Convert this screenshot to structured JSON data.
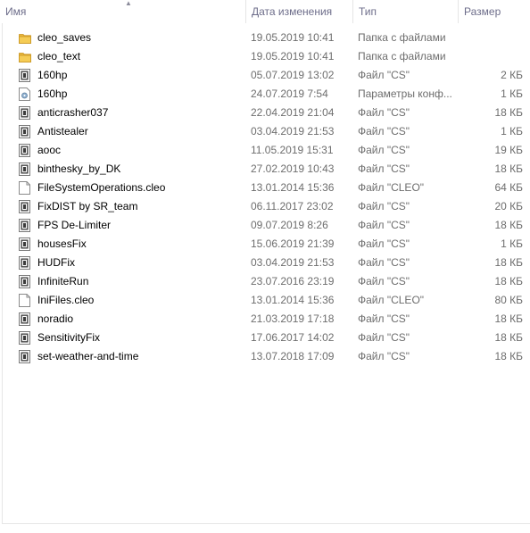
{
  "columns": {
    "name": "Имя",
    "date": "Дата изменения",
    "type": "Тип",
    "size": "Размер"
  },
  "files": [
    {
      "icon": "folder-icon",
      "name": "cleo_saves",
      "date": "19.05.2019 10:41",
      "type": "Папка с файлами",
      "size": ""
    },
    {
      "icon": "folder-icon",
      "name": "cleo_text",
      "date": "19.05.2019 10:41",
      "type": "Папка с файлами",
      "size": ""
    },
    {
      "icon": "cs-file-icon",
      "name": "160hp",
      "date": "05.07.2019 13:02",
      "type": "Файл \"CS\"",
      "size": "2 КБ"
    },
    {
      "icon": "settings-file-icon",
      "name": "160hp",
      "date": "24.07.2019 7:54",
      "type": "Параметры конф...",
      "size": "1 КБ"
    },
    {
      "icon": "cs-file-icon",
      "name": "anticrasher037",
      "date": "22.04.2019 21:04",
      "type": "Файл \"CS\"",
      "size": "18 КБ"
    },
    {
      "icon": "cs-file-icon",
      "name": "Antistealer",
      "date": "03.04.2019 21:53",
      "type": "Файл \"CS\"",
      "size": "1 КБ"
    },
    {
      "icon": "cs-file-icon",
      "name": "aooc",
      "date": "11.05.2019 15:31",
      "type": "Файл \"CS\"",
      "size": "19 КБ"
    },
    {
      "icon": "cs-file-icon",
      "name": "binthesky_by_DK",
      "date": "27.02.2019 10:43",
      "type": "Файл \"CS\"",
      "size": "18 КБ"
    },
    {
      "icon": "blank-file-icon",
      "name": "FileSystemOperations.cleo",
      "date": "13.01.2014 15:36",
      "type": "Файл \"CLEO\"",
      "size": "64 КБ"
    },
    {
      "icon": "cs-file-icon",
      "name": "FixDIST by SR_team",
      "date": "06.11.2017 23:02",
      "type": "Файл \"CS\"",
      "size": "20 КБ"
    },
    {
      "icon": "cs-file-icon",
      "name": "FPS De-Limiter",
      "date": "09.07.2019 8:26",
      "type": "Файл \"CS\"",
      "size": "18 КБ"
    },
    {
      "icon": "cs-file-icon",
      "name": "housesFix",
      "date": "15.06.2019 21:39",
      "type": "Файл \"CS\"",
      "size": "1 КБ"
    },
    {
      "icon": "cs-file-icon",
      "name": "HUDFix",
      "date": "03.04.2019 21:53",
      "type": "Файл \"CS\"",
      "size": "18 КБ"
    },
    {
      "icon": "cs-file-icon",
      "name": "InfiniteRun",
      "date": "23.07.2016 23:19",
      "type": "Файл \"CS\"",
      "size": "18 КБ"
    },
    {
      "icon": "blank-file-icon",
      "name": "IniFiles.cleo",
      "date": "13.01.2014 15:36",
      "type": "Файл \"CLEO\"",
      "size": "80 КБ"
    },
    {
      "icon": "cs-file-icon",
      "name": "noradio",
      "date": "21.03.2019 17:18",
      "type": "Файл \"CS\"",
      "size": "18 КБ"
    },
    {
      "icon": "cs-file-icon",
      "name": "SensitivityFix",
      "date": "17.06.2017 14:02",
      "type": "Файл \"CS\"",
      "size": "18 КБ"
    },
    {
      "icon": "cs-file-icon",
      "name": "set-weather-and-time",
      "date": "13.07.2018 17:09",
      "type": "Файл \"CS\"",
      "size": "18 КБ"
    }
  ]
}
